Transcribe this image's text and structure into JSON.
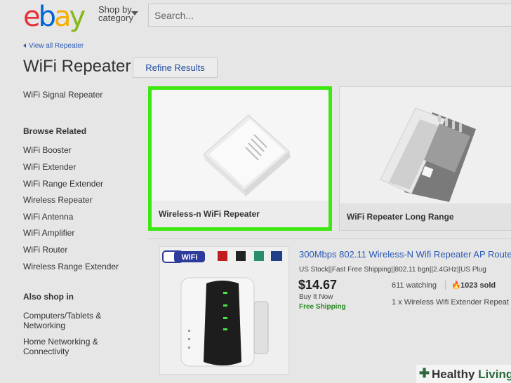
{
  "header": {
    "logo": {
      "letters": [
        "e",
        "b",
        "a",
        "y"
      ],
      "colors": [
        "#e53238",
        "#0064d2",
        "#f5af02",
        "#86b817"
      ]
    },
    "shop_by_line1": "Shop by",
    "shop_by_line2": "category",
    "search_placeholder": "Search..."
  },
  "back_link": "View all Repeater",
  "page_title": "WiFi Repeater",
  "refine_button": "Refine Results",
  "sidebar": {
    "top_link": "WiFi Signal Repeater",
    "browse_related_heading": "Browse Related",
    "browse_related": [
      "WiFi Booster",
      "WiFi Extender",
      "WiFi Range Extender",
      "Wireless Repeater",
      "WiFi Antenna",
      "WiFi Amplifier",
      "WiFi Router",
      "Wireless Range Extender"
    ],
    "also_shop_heading": "Also shop in",
    "also_shop": [
      {
        "line1": "Computers/Tablets &",
        "line2": "Networking"
      },
      {
        "line1": "Home Networking &",
        "line2": "Connectivity"
      }
    ]
  },
  "cards": [
    {
      "caption": "Wireless-n WiFi Repeater",
      "highlighted": true
    },
    {
      "caption": "WiFi Repeater Long Range",
      "highlighted": false
    }
  ],
  "listing": {
    "title": "300Mbps 802.11 Wireless-N Wifi Repeater AP Route",
    "subtitle": "US Stock||Fast Free Shipping||802.11 bgn||2.4GHz||US Plug",
    "price": "$14.67",
    "buy_format": "Buy It Now",
    "shipping": "Free Shipping",
    "watching": "611 watching",
    "sold": "1023 sold",
    "quantity": "1 x Wireless Wifi Extender Repeat"
  },
  "watermark": {
    "plus": "✚",
    "word1": "Healthy",
    "word2": "Living"
  },
  "colors": {
    "highlight": "#3de812",
    "link": "#2a58b5",
    "shipping": "#2b8a22"
  }
}
